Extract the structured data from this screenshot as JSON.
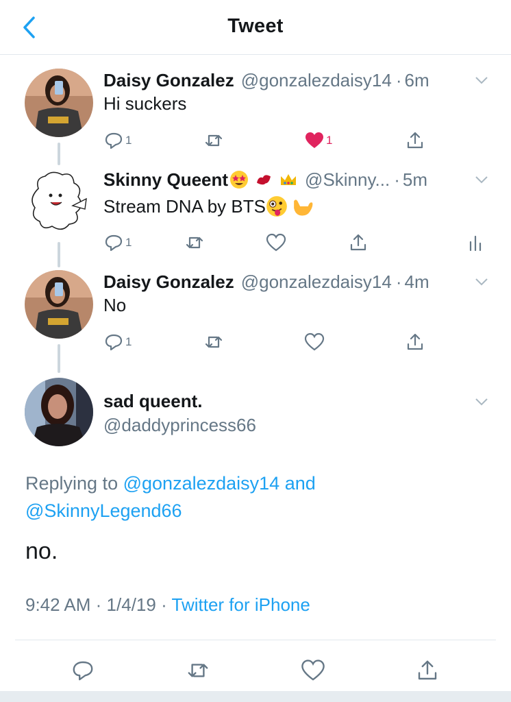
{
  "header": {
    "title": "Tweet"
  },
  "colors": {
    "accent": "#1da1f2",
    "like": "#e0245e",
    "muted": "#657786",
    "text": "#14171a"
  },
  "thread": [
    {
      "name": "Daisy Gonzalez",
      "handle": "@gonzalezdaisy14",
      "sep": "·",
      "time": "6m",
      "text": "Hi suckers",
      "reply_count": "1",
      "retweet_count": "",
      "like_count": "1",
      "liked": true
    },
    {
      "name": "Skinny Queent",
      "name_emojis": [
        "star-struck-emoji",
        "kiss-mark-emoji",
        "crown-emoji"
      ],
      "handle": "@Skinny...",
      "sep": "·",
      "time": "5m",
      "text": "Stream DNA by BTS",
      "text_emojis": [
        "zany-face-emoji",
        "call-me-hand-emoji"
      ],
      "reply_count": "1",
      "retweet_count": "",
      "like_count": ""
    },
    {
      "name": "Daisy Gonzalez",
      "handle": "@gonzalezdaisy14",
      "sep": "·",
      "time": "4m",
      "text": "No",
      "reply_count": "1",
      "retweet_count": "",
      "like_count": ""
    }
  ],
  "main": {
    "name": "sad queent.",
    "handle": "@daddyprincess66",
    "replying_prefix": "Replying to",
    "replying_user1": "@gonzalezdaisy14",
    "replying_and": "and",
    "replying_user2": "@SkinnyLegend66",
    "text": "no.",
    "time": "9:42 AM",
    "date": "1/4/19",
    "sep": "·",
    "source": "Twitter for iPhone"
  }
}
